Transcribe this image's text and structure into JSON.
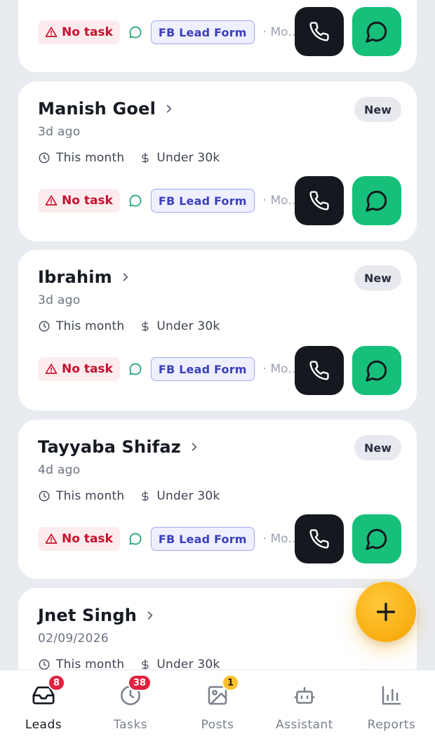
{
  "leads": [
    {
      "name": "",
      "status": "",
      "time_ago": "",
      "timeline": "",
      "budget": "",
      "task": "No task",
      "source": "FB Lead Form",
      "more": "· Mo..."
    },
    {
      "name": "Manish Goel",
      "status": "New",
      "time_ago": "3d ago",
      "timeline": "This month",
      "budget": "Under 30k",
      "task": "No task",
      "source": "FB Lead Form",
      "more": "· Mo..."
    },
    {
      "name": "Ibrahim",
      "status": "New",
      "time_ago": "3d ago",
      "timeline": "This month",
      "budget": "Under 30k",
      "task": "No task",
      "source": "FB Lead Form",
      "more": "· Mo..."
    },
    {
      "name": "Tayyaba Shifaz",
      "status": "New",
      "time_ago": "4d ago",
      "timeline": "This month",
      "budget": "Under 30k",
      "task": "No task",
      "source": "FB Lead Form",
      "more": "· Mo..."
    },
    {
      "name": "Jnet Singh",
      "status": "",
      "time_ago": "02/09/2026",
      "timeline": "This month",
      "budget": "Under 30k",
      "task": "",
      "source": "",
      "more": ""
    }
  ],
  "tabs": [
    {
      "label": "Leads",
      "badge": "8",
      "icon": "inbox-icon",
      "active": true
    },
    {
      "label": "Tasks",
      "badge": "38",
      "icon": "clock-icon",
      "active": false
    },
    {
      "label": "Posts",
      "badge": "1",
      "icon": "image-icon",
      "active": false
    },
    {
      "label": "Assistant",
      "badge": "",
      "icon": "bot-icon",
      "active": false
    },
    {
      "label": "Reports",
      "badge": "",
      "icon": "bar-chart-icon",
      "active": false
    }
  ],
  "colors": {
    "call_button": "#15191f",
    "whatsapp_button": "#16c07a",
    "fab": "#f5a300",
    "no_task": "#c8102e",
    "source_tag": "#3b3fbf",
    "badge_red": "#e1213f",
    "badge_yellow": "#fbc02d"
  }
}
